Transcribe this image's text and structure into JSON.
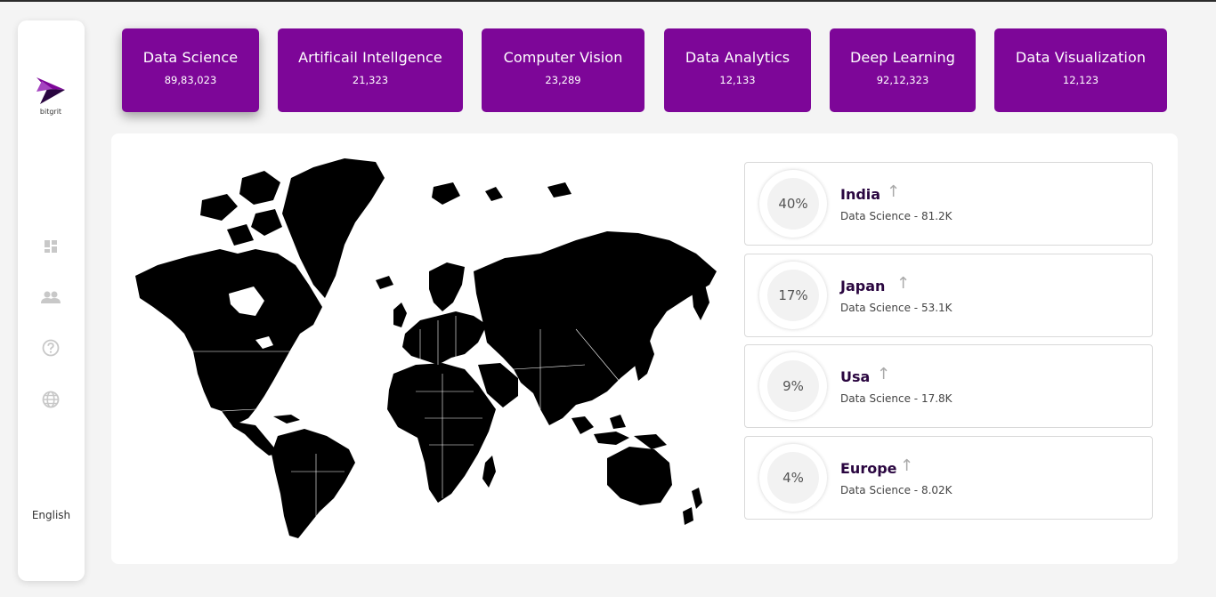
{
  "sidebar": {
    "logo_text": "bitgrit",
    "icons": [
      "dashboard-icon",
      "people-icon",
      "help-icon",
      "globe-icon"
    ],
    "language": "English"
  },
  "cards": [
    {
      "title": "Data Science",
      "value": "89,83,023"
    },
    {
      "title": "Artificail Intellgence",
      "value": "21,323"
    },
    {
      "title": "Computer Vision",
      "value": "23,289"
    },
    {
      "title": "Data Analytics",
      "value": "12,133"
    },
    {
      "title": "Deep Learning",
      "value": "92,12,323"
    },
    {
      "title": "Data Visualization",
      "value": "12,123"
    }
  ],
  "stats": [
    {
      "percent": "40%",
      "country": "India",
      "desc": "Data Science - 81.2K"
    },
    {
      "percent": "17%",
      "country": "Japan",
      "desc": "Data Science - 53.1K"
    },
    {
      "percent": "9%",
      "country": "Usa",
      "desc": "Data Science - 17.8K"
    },
    {
      "percent": "4%",
      "country": "Europe",
      "desc": "Data Science - 8.02K"
    }
  ],
  "colors": {
    "brand_purple": "#7d0698",
    "country_text": "#2a0640",
    "map_fill": "#000000"
  }
}
